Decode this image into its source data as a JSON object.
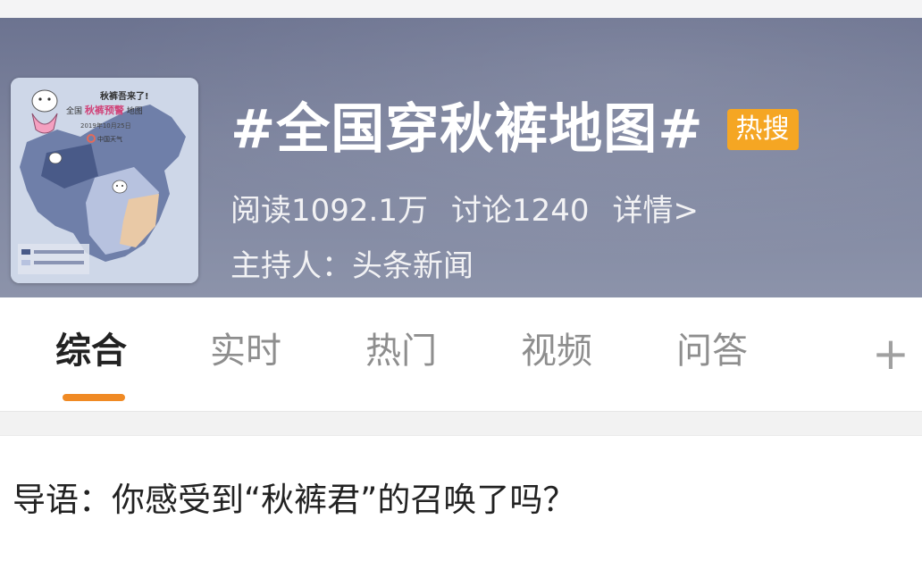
{
  "header": {
    "topic_title": "#全国穿秋裤地图#",
    "hot_badge": "热搜",
    "reads_label": "阅读1092.1万",
    "discussions_label": "讨论1240",
    "details_link": "详情>",
    "host_label": "主持人：头条新闻",
    "thumbnail": {
      "headline": "秋裤吾来了!",
      "subtitle_prefix": "全国",
      "subtitle_highlight": "秋裤预警",
      "subtitle_suffix": "地图",
      "date": "2019年10月25日",
      "brand": "中国天气"
    }
  },
  "tabs": [
    {
      "label": "综合",
      "active": true
    },
    {
      "label": "实时",
      "active": false
    },
    {
      "label": "热门",
      "active": false
    },
    {
      "label": "视频",
      "active": false
    },
    {
      "label": "问答",
      "active": false
    }
  ],
  "add_tab_symbol": "+",
  "intro_text": "导语：你感受到“秋裤君”的召唤了吗？",
  "colors": {
    "banner": "#7d849e",
    "badge": "#f5a623",
    "tab_indicator": "#f08a24",
    "active_tab": "#222222",
    "inactive_tab": "#8e8e8e"
  }
}
